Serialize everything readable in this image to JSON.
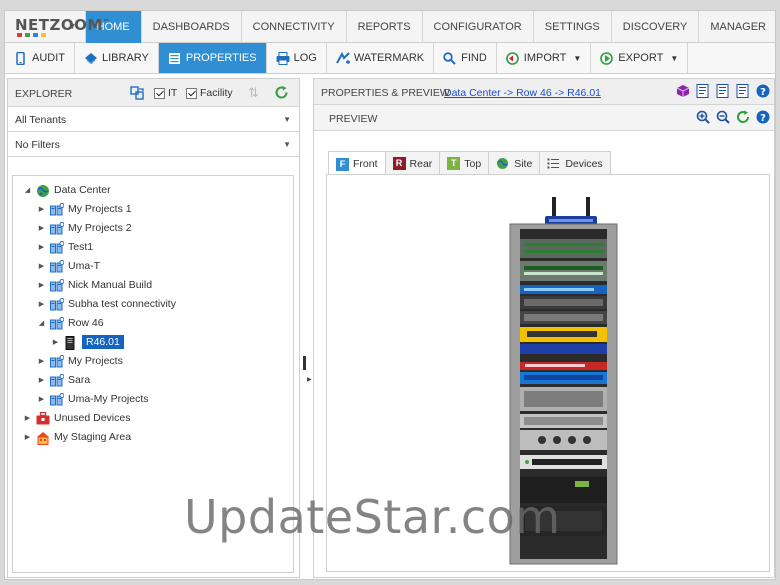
{
  "app": {
    "brand": "NETZOOM",
    "brand_mark": "™"
  },
  "nav": {
    "tabs": [
      {
        "label": "HOME",
        "active": true
      },
      {
        "label": "DASHBOARDS"
      },
      {
        "label": "CONNECTIVITY"
      },
      {
        "label": "REPORTS"
      },
      {
        "label": "CONFIGURATOR"
      },
      {
        "label": "SETTINGS"
      },
      {
        "label": "DISCOVERY"
      },
      {
        "label": "MANAGER"
      }
    ]
  },
  "toolbar": {
    "audit": "AUDIT",
    "library": "LIBRARY",
    "properties": "PROPERTIES",
    "log": "LOG",
    "watermark": "WATERMARK",
    "find": "FIND",
    "import": "IMPORT",
    "export": "EXPORT"
  },
  "explorer": {
    "title": "EXPLORER",
    "it_label": "IT",
    "facility_label": "Facility",
    "tenant_filter": "All Tenants",
    "filter": "No Filters",
    "tree": [
      {
        "label": "Data Center"
      },
      {
        "label": "My Projects 1"
      },
      {
        "label": "My Projects 2"
      },
      {
        "label": "Test1"
      },
      {
        "label": "Uma-T"
      },
      {
        "label": "Nick Manual Build"
      },
      {
        "label": "Subha test connectivity"
      },
      {
        "label": "Row 46"
      },
      {
        "label": "R46.01"
      },
      {
        "label": "My Projects"
      },
      {
        "label": "Sara"
      },
      {
        "label": "Uma-My Projects"
      },
      {
        "label": "Unused Devices"
      },
      {
        "label": "My Staging Area"
      }
    ]
  },
  "properties": {
    "title": "PROPERTIES & PREVIEW",
    "breadcrumb": "Data Center -> Row 46 -> R46.01",
    "preview_title": "PREVIEW",
    "view_tabs": [
      {
        "letter": "F",
        "label": "Front",
        "active": true
      },
      {
        "letter": "R",
        "label": "Rear"
      },
      {
        "letter": "T",
        "label": "Top"
      },
      {
        "letter": "",
        "label": "Site"
      },
      {
        "letter": "",
        "label": "Devices"
      }
    ]
  },
  "watermark": "UpdateStar.com",
  "colors": {
    "accent": "#2f8fd2",
    "selection": "#1565c0",
    "link": "#1a4fd0",
    "refresh": "#2e9e3e"
  }
}
